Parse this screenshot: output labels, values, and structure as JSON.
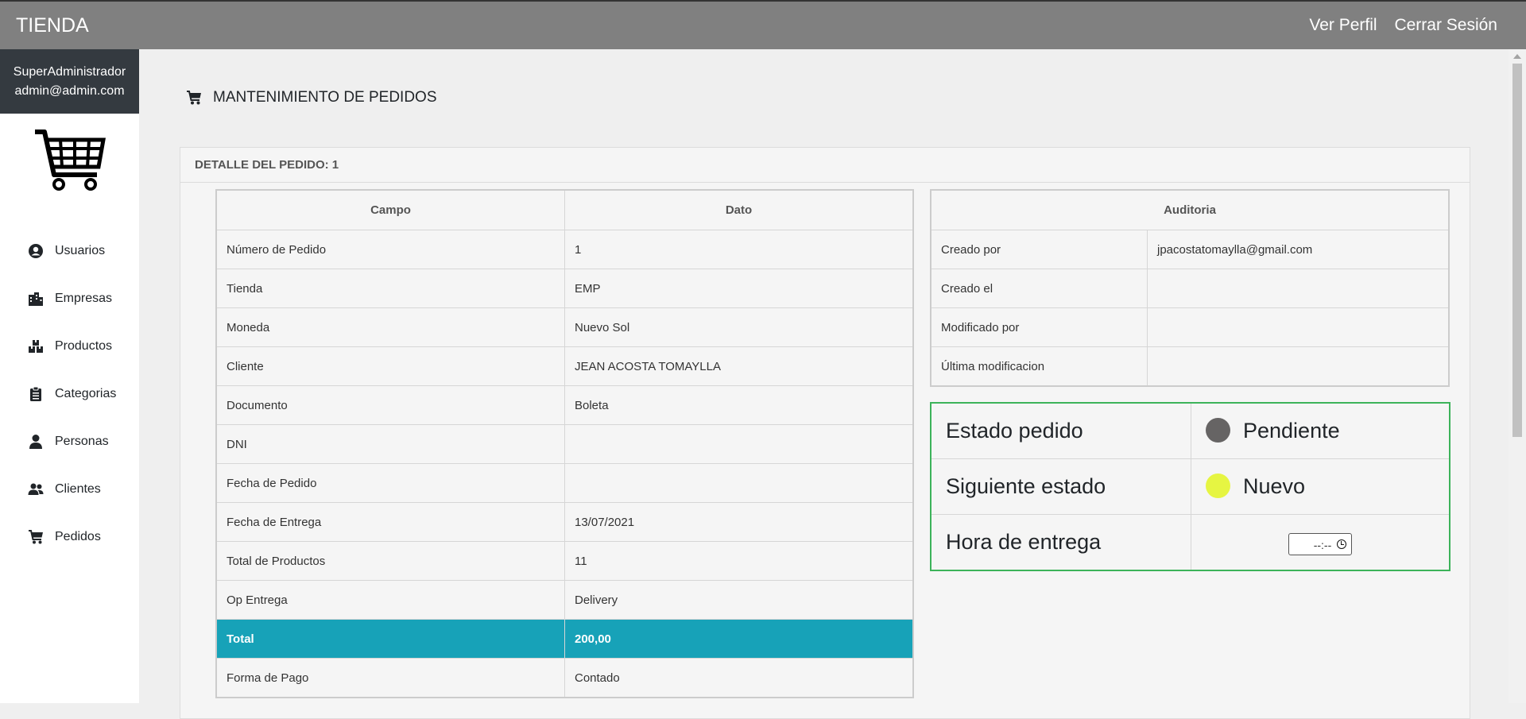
{
  "header": {
    "brand": "TIENDA",
    "view_profile": "Ver Perfil",
    "logout": "Cerrar Sesión"
  },
  "sidebar": {
    "user_role": "SuperAdministrador",
    "user_email": "admin@admin.com",
    "items": [
      {
        "label": "Usuarios",
        "icon": "user-circle-icon"
      },
      {
        "label": "Empresas",
        "icon": "building-icon"
      },
      {
        "label": "Productos",
        "icon": "boxes-icon"
      },
      {
        "label": "Categorias",
        "icon": "clipboard-icon"
      },
      {
        "label": "Personas",
        "icon": "user-icon"
      },
      {
        "label": "Clientes",
        "icon": "users-icon"
      },
      {
        "label": "Pedidos",
        "icon": "cart-icon"
      }
    ]
  },
  "page": {
    "title": "MANTENIMIENTO DE PEDIDOS",
    "card_title": "DETALLE DEL PEDIDO: 1"
  },
  "detail_table": {
    "headers": [
      "Campo",
      "Dato"
    ],
    "rows": [
      [
        "Número de Pedido",
        "1"
      ],
      [
        "Tienda",
        "EMP"
      ],
      [
        "Moneda",
        "Nuevo Sol"
      ],
      [
        "Cliente",
        "JEAN ACOSTA TOMAYLLA"
      ],
      [
        "Documento",
        "Boleta"
      ],
      [
        "DNI",
        ""
      ],
      [
        "Fecha de Pedido",
        ""
      ],
      [
        "Fecha de Entrega",
        "13/07/2021"
      ],
      [
        "Total de Productos",
        "11"
      ],
      [
        "Op Entrega",
        "Delivery"
      ],
      [
        "Total",
        "200,00"
      ],
      [
        "Forma de Pago",
        "Contado"
      ]
    ]
  },
  "audit_table": {
    "header": "Auditoria",
    "rows": [
      [
        "Creado por",
        "jpacostatomaylla@gmail.com"
      ],
      [
        "Creado el",
        ""
      ],
      [
        "Modificado por",
        ""
      ],
      [
        "Última modificacion",
        ""
      ]
    ]
  },
  "status": {
    "current_label": "Estado pedido",
    "current_value": "Pendiente",
    "current_color": "#666464",
    "next_label": "Siguiente estado",
    "next_value": "Nuevo",
    "next_color": "#e6f542",
    "delivery_time_label": "Hora de entrega",
    "delivery_time_value": "--:--"
  },
  "colors": {
    "topbar": "#808080",
    "highlight_row": "#17a2b8",
    "status_border": "#3cb35a"
  }
}
